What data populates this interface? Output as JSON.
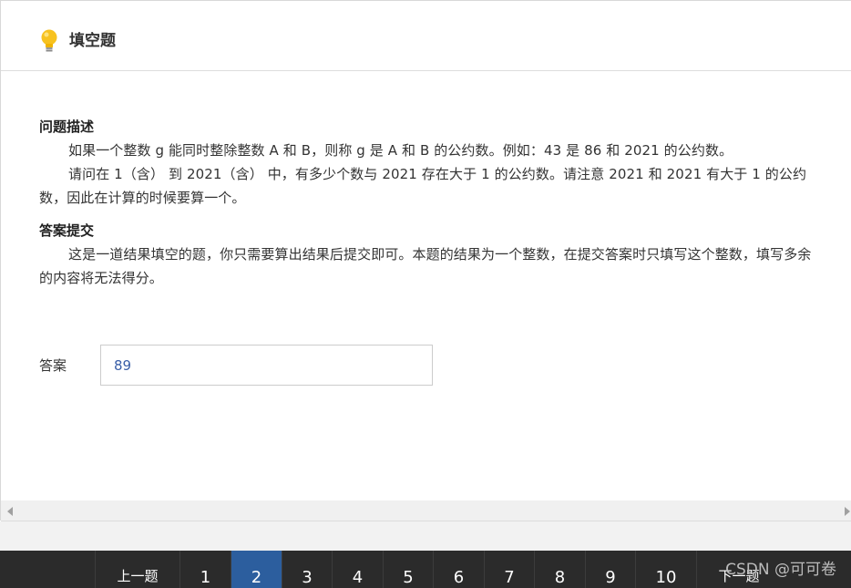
{
  "header": {
    "title": "填空题",
    "icon": "lightbulb-icon"
  },
  "problem": {
    "heading": "问题描述",
    "paragraph1": "如果一个整数 g 能同时整除整数 A 和 B，则称 g 是 A 和 B 的公约数。例如：43 是 86 和 2021 的公约数。",
    "paragraph2": "请问在 1（含） 到 2021（含） 中，有多少个数与 2021 存在大于 1 的公约数。请注意 2021 和 2021 有大于 1 的公约数，因此在计算的时候要算一个。"
  },
  "submit": {
    "heading": "答案提交",
    "paragraph": "这是一道结果填空的题，你只需要算出结果后提交即可。本题的结果为一个整数，在提交答案时只填写这个整数，填写多余的内容将无法得分。"
  },
  "answer": {
    "label": "答案",
    "value": "89"
  },
  "nav": {
    "prev_label": "上一题",
    "next_label": "下一题",
    "pages": [
      "1",
      "2",
      "3",
      "4",
      "5",
      "6",
      "7",
      "8",
      "9",
      "10"
    ],
    "active_page": "2",
    "active_color": "#2c5e9e"
  },
  "watermark": "CSDN @可可卷"
}
